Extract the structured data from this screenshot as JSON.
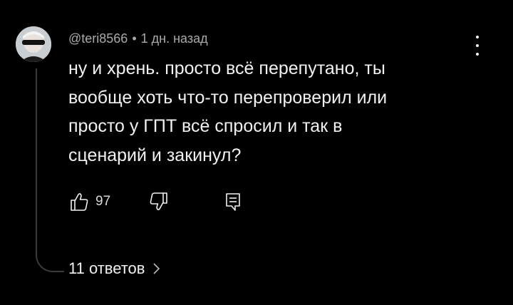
{
  "comment": {
    "author": "@teri8566",
    "separator": "•",
    "time": "1 дн. назад",
    "text_lines": [
      "ну и хрень. просто всё перепутано, ты",
      "вообще хоть что-то перепроверил или",
      "просто у ГПТ всё спросил и так в",
      "сценарий и закинул?"
    ],
    "likes": "97",
    "replies_label": "11 ответов"
  },
  "icons": {
    "more": "vertical-dots-icon",
    "like": "thumbs-up-icon",
    "dislike": "thumbs-down-icon",
    "reply": "reply-icon",
    "replies": "chevron-right-icon"
  },
  "colors": {
    "background": "#000000",
    "text": "#f1f1f1",
    "meta": "#aaaaaa",
    "thread_line": "#3a3a3a"
  }
}
